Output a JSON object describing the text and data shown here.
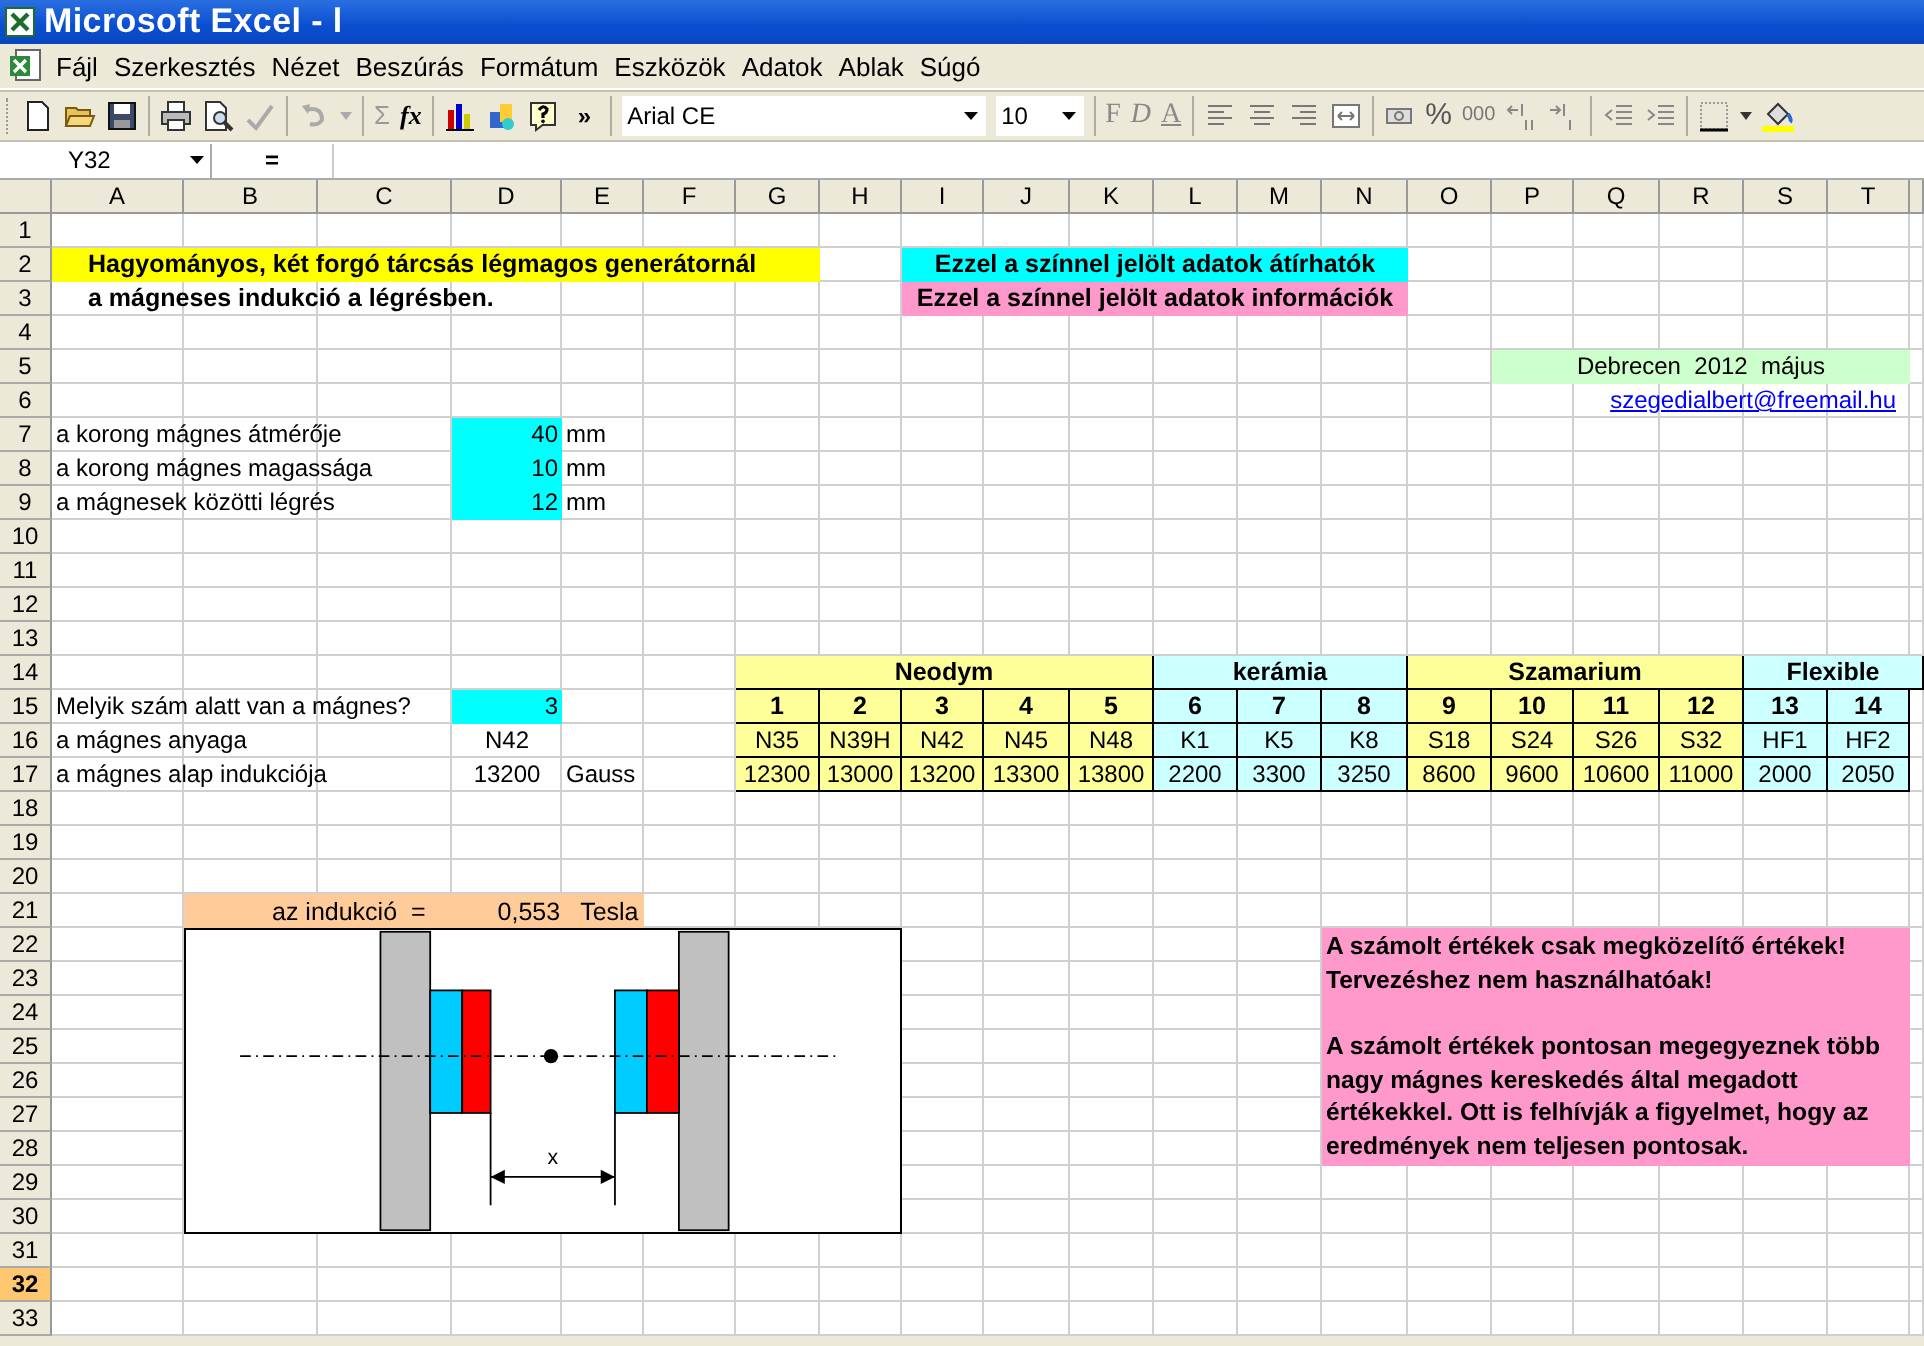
{
  "window": {
    "title": "Microsoft Excel - l"
  },
  "menu": [
    "Fájl",
    "Szerkesztés",
    "Nézet",
    "Beszúrás",
    "Formátum",
    "Eszközök",
    "Adatok",
    "Ablak",
    "Súgó"
  ],
  "toolbar": {
    "sum": "Σ",
    "fx": "fx",
    "overflow": "»",
    "font": "Arial CE",
    "size": "10",
    "bold": "F",
    "italic": "D",
    "underline": "A",
    "percent": "%",
    "thousands": "000"
  },
  "formula_bar": {
    "name_box": "Y32",
    "equals": "="
  },
  "columns": [
    "A",
    "B",
    "C",
    "D",
    "E",
    "F",
    "G",
    "H",
    "I",
    "J",
    "K",
    "L",
    "M",
    "N",
    "O",
    "P",
    "Q",
    "R",
    "S",
    "T"
  ],
  "rows": [
    {
      "label": "1",
      "selected": false
    },
    {
      "label": "2",
      "selected": false
    },
    {
      "label": "3",
      "selected": false
    },
    {
      "label": "4",
      "selected": false
    },
    {
      "label": "5",
      "selected": false
    },
    {
      "label": "6",
      "selected": false
    },
    {
      "label": "7",
      "selected": false
    },
    {
      "label": "8",
      "selected": false
    },
    {
      "label": "9",
      "selected": false
    },
    {
      "label": "10",
      "selected": false
    },
    {
      "label": "11",
      "selected": false
    },
    {
      "label": "12",
      "selected": false
    },
    {
      "label": "13",
      "selected": false
    },
    {
      "label": "14",
      "selected": false
    },
    {
      "label": "15",
      "selected": false
    },
    {
      "label": "16",
      "selected": false
    },
    {
      "label": "17",
      "selected": false
    },
    {
      "label": "18",
      "selected": false
    },
    {
      "label": "19",
      "selected": false
    },
    {
      "label": "20",
      "selected": false
    },
    {
      "label": "21",
      "selected": false
    },
    {
      "label": "22",
      "selected": false
    },
    {
      "label": "23",
      "selected": false
    },
    {
      "label": "24",
      "selected": false
    },
    {
      "label": "25",
      "selected": false
    },
    {
      "label": "26",
      "selected": false
    },
    {
      "label": "27",
      "selected": false
    },
    {
      "label": "28",
      "selected": false
    },
    {
      "label": "29",
      "selected": false
    },
    {
      "label": "30",
      "selected": false
    },
    {
      "label": "31",
      "selected": false
    },
    {
      "label": "32",
      "selected": true
    },
    {
      "label": "33",
      "selected": false
    }
  ],
  "title_lines": [
    "Hagyományos, két forgó tárcsás légmagos generátornál",
    "a mágneses indukció a légrésben."
  ],
  "legend": [
    {
      "text": "Ezzel a színnel jelölt adatok átírhatók",
      "color": "#00ffff"
    },
    {
      "text": "Ezzel a színnel jelölt adatok információk",
      "color": "#ff99cc"
    }
  ],
  "credit": {
    "text": "Debrecen  2012  május",
    "email": "szegedialbert@freemail.hu"
  },
  "params": [
    {
      "label": "a korong mágnes átmérője",
      "value": "40",
      "unit": "mm"
    },
    {
      "label": "a korong mágnes magassága",
      "value": "10",
      "unit": "mm"
    },
    {
      "label": "a mágnesek közötti légrés",
      "value": "12",
      "unit": "mm"
    }
  ],
  "question": {
    "label": "Melyik szám alatt van a mágnes?",
    "value": "3"
  },
  "material": {
    "label": "a mágnes anyaga",
    "value": "N42"
  },
  "base_induction": {
    "label": "a mágnes alap indukciója",
    "value": "13200",
    "unit": "Gauss"
  },
  "magnet_table": [
    {
      "name": "Neodym",
      "color": "#ffff99",
      "items": [
        {
          "number": "1",
          "code": "N35",
          "induction": "12300"
        },
        {
          "number": "2",
          "code": "N39H",
          "induction": "13000"
        },
        {
          "number": "3",
          "code": "N42",
          "induction": "13200"
        },
        {
          "number": "4",
          "code": "N45",
          "induction": "13300"
        },
        {
          "number": "5",
          "code": "N48",
          "induction": "13800"
        }
      ]
    },
    {
      "name": "kerámia",
      "color": "#ccffff",
      "items": [
        {
          "number": "6",
          "code": "K1",
          "induction": "2200"
        },
        {
          "number": "7",
          "code": "K5",
          "induction": "3300"
        },
        {
          "number": "8",
          "code": "K8",
          "induction": "3250"
        }
      ]
    },
    {
      "name": "Szamarium",
      "color": "#ffff99",
      "items": [
        {
          "number": "9",
          "code": "S18",
          "induction": "8600"
        },
        {
          "number": "10",
          "code": "S24",
          "induction": "9600"
        },
        {
          "number": "11",
          "code": "S26",
          "induction": "10600"
        },
        {
          "number": "12",
          "code": "S32",
          "induction": "11000"
        }
      ]
    },
    {
      "name": "Flexible",
      "color": "#ccffff",
      "items": [
        {
          "number": "13",
          "code": "HF1",
          "induction": "2000"
        },
        {
          "number": "14",
          "code": "HF2",
          "induction": "2050"
        }
      ]
    }
  ],
  "result": {
    "label": "az indukció  =",
    "value": "0,553",
    "unit": "Tesla"
  },
  "diagram": {
    "dimension_label": "x"
  },
  "note": [
    "A számolt értékek csak megközelítő értékek! Tervezéshez nem használhatóak!",
    "A számolt értékek pontosan megegyeznek több nagy mágnes kereskedés által megadott értékekkel. Ott is felhívják a figyelmet, hogy az eredmények nem teljesen pontosak."
  ]
}
